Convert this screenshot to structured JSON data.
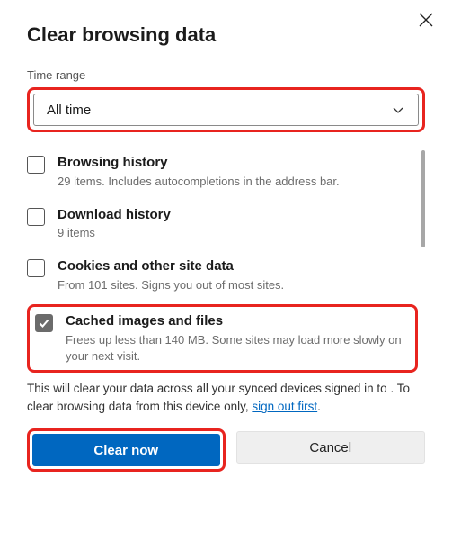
{
  "title": "Clear browsing data",
  "timeRange": {
    "label": "Time range",
    "value": "All time"
  },
  "items": [
    {
      "title": "Browsing history",
      "sub": "29 items. Includes autocompletions in the address bar.",
      "checked": false
    },
    {
      "title": "Download history",
      "sub": "9 items",
      "checked": false
    },
    {
      "title": "Cookies and other site data",
      "sub": "From 101 sites. Signs you out of most sites.",
      "checked": false
    },
    {
      "title": "Cached images and files",
      "sub": "Frees up less than 140 MB. Some sites may load more slowly on your next visit.",
      "checked": true
    }
  ],
  "info": {
    "part1": "This will clear your data across all your synced devices signed in to ",
    "part2": ". To clear browsing data from this device only, ",
    "link": "sign out first",
    "part3": "."
  },
  "buttons": {
    "primary": "Clear now",
    "secondary": "Cancel"
  }
}
